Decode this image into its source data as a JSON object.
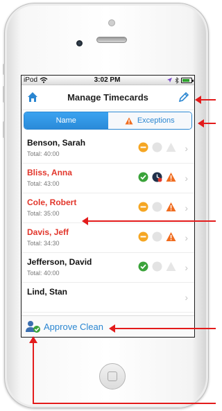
{
  "statusbar": {
    "carrier": "iPod",
    "time": "3:02 PM"
  },
  "navbar": {
    "title": "Manage Timecards"
  },
  "segments": [
    {
      "label": "Name",
      "active": true
    },
    {
      "label": "Exceptions",
      "active": false
    }
  ],
  "employees": [
    {
      "name": "Benson, Sarah",
      "total": "Total: 40:00",
      "flagged": false,
      "icons": [
        "pending",
        "grey-dot",
        "grey-warning"
      ]
    },
    {
      "name": "Bliss, Anna",
      "total": "Total: 43:00",
      "flagged": true,
      "icons": [
        "approved",
        "clock",
        "warning"
      ]
    },
    {
      "name": "Cole, Robert",
      "total": "Total: 35:00",
      "flagged": true,
      "icons": [
        "pending",
        "grey-dot",
        "warning"
      ]
    },
    {
      "name": "Davis, Jeff",
      "total": "Total: 34:30",
      "flagged": true,
      "icons": [
        "pending",
        "grey-dot",
        "warning"
      ]
    },
    {
      "name": "Jefferson, David",
      "total": "Total: 40:00",
      "flagged": false,
      "icons": [
        "approved",
        "grey-dot",
        "grey-warning"
      ]
    },
    {
      "name": "Lind, Stan",
      "total": "",
      "flagged": false,
      "icons": []
    }
  ],
  "toolbar": {
    "approve_label": "Approve Clean"
  },
  "colors": {
    "accent": "#2a86d1",
    "flag_red": "#e2362b",
    "pending_orange": "#f5a623",
    "approved_green": "#3aa33a",
    "callout_red": "#e31b1b"
  }
}
